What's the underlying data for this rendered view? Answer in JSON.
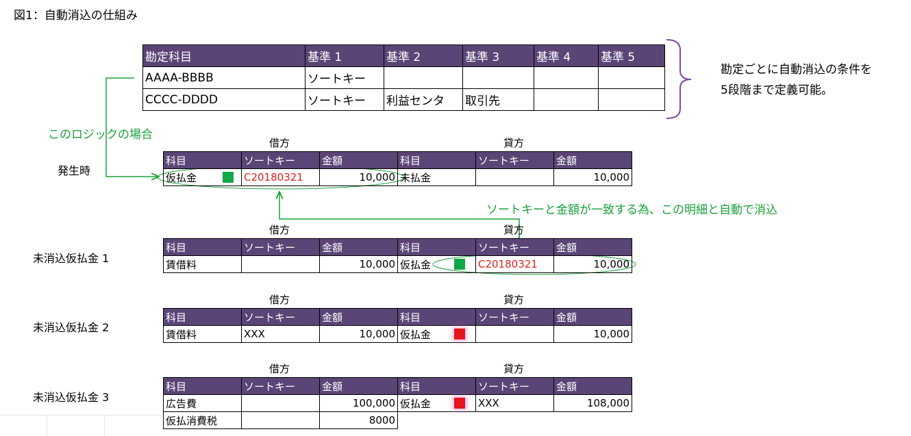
{
  "title": "図1：自動消込の仕組み",
  "colors": {
    "header_bg": "#5b4577",
    "accent_green": "#1aa03a",
    "red_text": "#e02020",
    "bracket": "#7a4aa0"
  },
  "criteria_table": {
    "headers": [
      "勘定科目",
      "基準 1",
      "基準 2",
      "基準 3",
      "基準 4",
      "基準 5"
    ],
    "rows": [
      [
        "AAAA-BBBB",
        "ソートキー",
        "",
        "",
        "",
        ""
      ],
      [
        "CCCC-DDDD",
        "ソートキー",
        "利益センタ",
        "取引先",
        "",
        ""
      ]
    ]
  },
  "note": {
    "line1": "勘定ごとに自動消込の条件を",
    "line2": "5段階まで定義可能。"
  },
  "logic_label": "このロジックの場合",
  "match_label": "ソートキーと金額が一致する為、この明細と自動で消込",
  "debit_label": "借方",
  "credit_label": "貸方",
  "sub_headers": [
    "科目",
    "ソートキー",
    "金額",
    "科目",
    "ソートキー",
    "金額"
  ],
  "blocks": [
    {
      "label": "発生時",
      "rows": [
        {
          "d_acct": "仮払金",
          "d_marker": "green",
          "d_key": "C20180321",
          "d_key_red": true,
          "d_amt": "10,000",
          "c_acct": "未払金",
          "c_marker": "",
          "c_key": "",
          "c_key_red": false,
          "c_amt": "10,000"
        }
      ]
    },
    {
      "label": "未消込仮払金 1",
      "rows": [
        {
          "d_acct": "賃借料",
          "d_marker": "",
          "d_key": "",
          "d_key_red": false,
          "d_amt": "10,000",
          "c_acct": "仮払金",
          "c_marker": "green",
          "c_key": "C20180321",
          "c_key_red": true,
          "c_amt": "10,000"
        }
      ]
    },
    {
      "label": "未消込仮払金 2",
      "rows": [
        {
          "d_acct": "賃借料",
          "d_marker": "",
          "d_key": "XXX",
          "d_key_red": false,
          "d_amt": "10,000",
          "c_acct": "仮払金",
          "c_marker": "red",
          "c_key": "",
          "c_key_red": false,
          "c_amt": "10,000"
        }
      ]
    },
    {
      "label": "未消込仮払金 3",
      "rows": [
        {
          "d_acct": "広告費",
          "d_marker": "",
          "d_key": "",
          "d_key_red": false,
          "d_amt": "100,000",
          "c_acct": "仮払金",
          "c_marker": "red",
          "c_key": "XXX",
          "c_key_red": false,
          "c_amt": "108,000"
        },
        {
          "d_acct": "仮払消費税",
          "d_marker": "",
          "d_key": "",
          "d_key_red": false,
          "d_amt": "8000",
          "c_acct": "",
          "c_marker": "",
          "c_key": "",
          "c_key_red": false,
          "c_amt": ""
        }
      ]
    }
  ]
}
